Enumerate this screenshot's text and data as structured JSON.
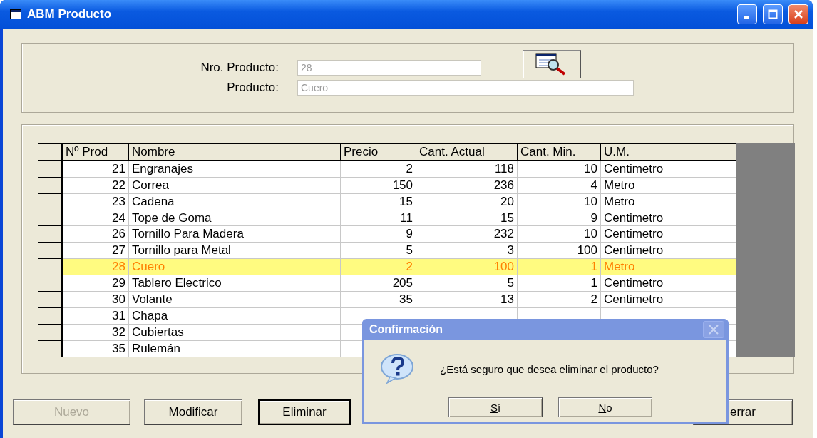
{
  "window": {
    "title": "ABM Producto"
  },
  "form": {
    "fields": [
      {
        "label": "Nro. Producto:",
        "value": "28",
        "kind": "short"
      },
      {
        "label": "Producto:",
        "value": "Cuero",
        "kind": "long"
      }
    ]
  },
  "table": {
    "columns": [
      {
        "label": "Nº Prod"
      },
      {
        "label": "Nombre"
      },
      {
        "label": "Precio"
      },
      {
        "label": "Cant. Actual"
      },
      {
        "label": "Cant. Min."
      },
      {
        "label": "U.M."
      }
    ],
    "rows": [
      {
        "cells": [
          "21",
          "Engranajes",
          "2",
          "118",
          "10",
          "Centimetro"
        ],
        "selected": false
      },
      {
        "cells": [
          "22",
          "Correa",
          "150",
          "236",
          "4",
          "Metro"
        ],
        "selected": false
      },
      {
        "cells": [
          "23",
          "Cadena",
          "15",
          "20",
          "10",
          "Metro"
        ],
        "selected": false
      },
      {
        "cells": [
          "24",
          "Tope de Goma",
          "11",
          "15",
          "9",
          "Centimetro"
        ],
        "selected": false
      },
      {
        "cells": [
          "26",
          "Tornillo Para Madera",
          "9",
          "232",
          "10",
          "Centimetro"
        ],
        "selected": false
      },
      {
        "cells": [
          "27",
          "Tornillo para Metal",
          "5",
          "3",
          "100",
          "Centimetro"
        ],
        "selected": false
      },
      {
        "cells": [
          "28",
          "Cuero",
          "2",
          "100",
          "1",
          "Metro"
        ],
        "selected": true
      },
      {
        "cells": [
          "29",
          "Tablero Electrico",
          "205",
          "5",
          "1",
          "Centimetro"
        ],
        "selected": false
      },
      {
        "cells": [
          "30",
          "Volante",
          "35",
          "13",
          "2",
          "Centimetro"
        ],
        "selected": false
      },
      {
        "cells": [
          "31",
          "Chapa"
        ],
        "selected": false
      },
      {
        "cells": [
          "32",
          "Cubiertas"
        ],
        "selected": false
      },
      {
        "cells": [
          "35",
          "Rulemán"
        ],
        "selected": false
      }
    ]
  },
  "buttons": [
    {
      "key": "N",
      "rest": "uevo",
      "disabled": true,
      "focused": false
    },
    {
      "key": "M",
      "rest": "odificar",
      "disabled": false,
      "focused": false
    },
    {
      "key": "E",
      "rest": "liminar",
      "disabled": false,
      "focused": true
    },
    {
      "rest": "errar",
      "disabled": false,
      "focused": false
    }
  ],
  "dialog": {
    "title": "Confirmación",
    "message": "¿Está seguro que desea eliminar el producto?",
    "buttons": [
      {
        "key": "S",
        "rest": "í"
      },
      {
        "key": "N",
        "rest": "o"
      }
    ]
  }
}
